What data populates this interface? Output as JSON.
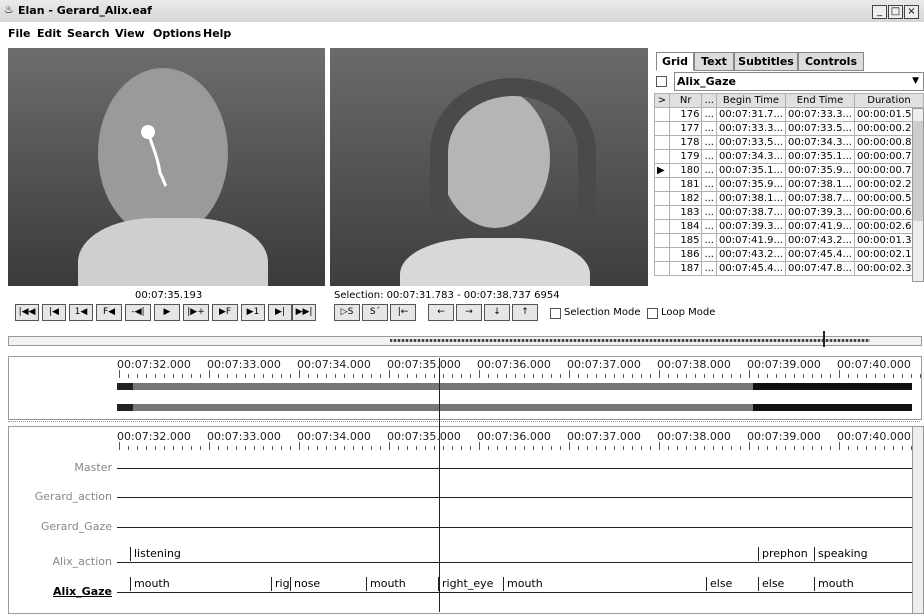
{
  "window": {
    "title": "Elan - Gerard_Alix.eaf",
    "controls": [
      "_",
      "□",
      "×"
    ]
  },
  "menu": [
    "File",
    "Edit",
    "Search",
    "View",
    "Options",
    "Help"
  ],
  "video": {
    "left_timecode": "00:07:35.193",
    "selection_text": "Selection: 00:07:31.783 - 00:07:38.737  6954"
  },
  "grid": {
    "tabs": [
      "Grid",
      "Text",
      "Subtitles",
      "Controls"
    ],
    "tier_select": "Alix_Gaze",
    "columns": [
      ">",
      "Nr",
      "...",
      "Begin Time",
      "End Time",
      "Duration"
    ],
    "rows": [
      {
        "nr": "176",
        "begin": "00:07:31.7...",
        "end": "00:07:33.3...",
        "dur": "00:00:01.5..."
      },
      {
        "nr": "177",
        "begin": "00:07:33.3...",
        "end": "00:07:33.5...",
        "dur": "00:00:00.2..."
      },
      {
        "nr": "178",
        "begin": "00:07:33.5...",
        "end": "00:07:34.3...",
        "dur": "00:00:00.8..."
      },
      {
        "nr": "179",
        "begin": "00:07:34.3...",
        "end": "00:07:35.1...",
        "dur": "00:00:00.7..."
      },
      {
        "nr": "180",
        "begin": "00:07:35.1...",
        "end": "00:07:35.9...",
        "dur": "00:00:00.7..."
      },
      {
        "nr": "181",
        "begin": "00:07:35.9...",
        "end": "00:07:38.1...",
        "dur": "00:00:02.2..."
      },
      {
        "nr": "182",
        "begin": "00:07:38.1...",
        "end": "00:07:38.7...",
        "dur": "00:00:00.5..."
      },
      {
        "nr": "183",
        "begin": "00:07:38.7...",
        "end": "00:07:39.3...",
        "dur": "00:00:00.6..."
      },
      {
        "nr": "184",
        "begin": "00:07:39.3...",
        "end": "00:07:41.9...",
        "dur": "00:00:02.6..."
      },
      {
        "nr": "185",
        "begin": "00:07:41.9...",
        "end": "00:07:43.2...",
        "dur": "00:00:01.3..."
      },
      {
        "nr": "186",
        "begin": "00:07:43.2...",
        "end": "00:07:45.4...",
        "dur": "00:00:02.1..."
      },
      {
        "nr": "187",
        "begin": "00:07:45.4...",
        "end": "00:07:47.8...",
        "dur": "00:00:02.3..."
      }
    ],
    "ellipsis": "..."
  },
  "player_buttons": [
    "|◀◀",
    "|◀",
    "1◀",
    "F◀",
    "-◀|",
    "▶",
    "|▶+",
    "▶F",
    "▶1",
    "▶|",
    "▶▶|"
  ],
  "selection_buttons": [
    "▷S",
    "S´",
    "|←"
  ],
  "arrow_buttons": [
    "←",
    "→",
    "↓",
    "↑"
  ],
  "modes": {
    "selection_mode": "Selection Mode",
    "loop_mode": "Loop Mode"
  },
  "ruler_labels": [
    "00:07:32.000",
    "00:07:33.000",
    "00:07:34.000",
    "00:07:35.000",
    "00:07:36.000",
    "00:07:37.000",
    "00:07:38.000",
    "00:07:39.000",
    "00:07:40.000"
  ],
  "tiers": [
    {
      "name": "Master",
      "annotations": []
    },
    {
      "name": "Gerard_action",
      "annotations": []
    },
    {
      "name": "Gerard_Gaze",
      "annotations": []
    },
    {
      "name": "Alix_action",
      "annotations": [
        "listening",
        "prephon",
        "speaking"
      ]
    },
    {
      "name": "Alix_Gaze",
      "annotations": [
        "mouth",
        "rig",
        "nose",
        "mouth",
        "right_eye",
        "mouth",
        "else",
        "else",
        "mouth"
      ]
    }
  ]
}
